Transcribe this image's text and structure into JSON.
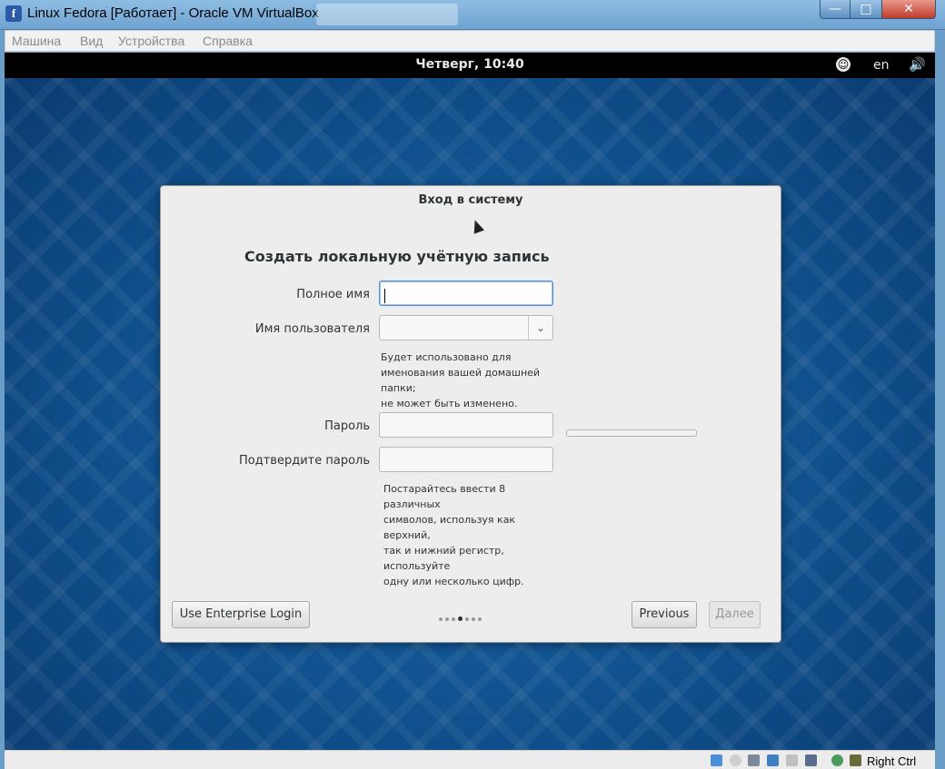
{
  "window": {
    "title": "Linux Fedora [Работает] - Oracle VM VirtualBox",
    "app_icon": "f",
    "controls": {
      "minimize": "—",
      "maximize": "□",
      "close": "✕"
    }
  },
  "menubar": {
    "items": [
      "Машина",
      "Вид",
      "Устройства",
      "Справка"
    ]
  },
  "guest_topbar": {
    "clock": "Четверг, 10:40",
    "language": "en",
    "accessibility_icon": "accessibility-icon",
    "volume_icon": "volume-icon"
  },
  "dialog": {
    "title": "Вход в систему",
    "heading": "Создать локальную учётную запись",
    "fields": {
      "fullname_label": "Полное имя",
      "fullname_value": "",
      "username_label": "Имя пользователя",
      "username_value": "",
      "username_hint": "Будет использовано для\nименования вашей домашней папки;\nне может быть изменено.",
      "password_label": "Пароль",
      "password_value": "",
      "confirm_label": "Подтвердите пароль",
      "confirm_value": "",
      "password_hint": "Постарайтесь ввести 8 различных\nсимволов, используя как верхний,\nтак и нижний регистр, используйте\nодну или несколько цифр."
    },
    "password_strength": 0,
    "buttons": {
      "enterprise": "Use Enterprise Login",
      "previous": "Previous",
      "next": "Далее"
    },
    "pager": {
      "total": 7,
      "current": 4
    }
  },
  "statusbar": {
    "host_key": "Right Ctrl",
    "icons": [
      "hdd-icon",
      "cd-icon",
      "usb-icon",
      "network-icon",
      "shared-folder-icon",
      "display-icon",
      "capture-icon",
      "mouse-integration-icon"
    ]
  }
}
